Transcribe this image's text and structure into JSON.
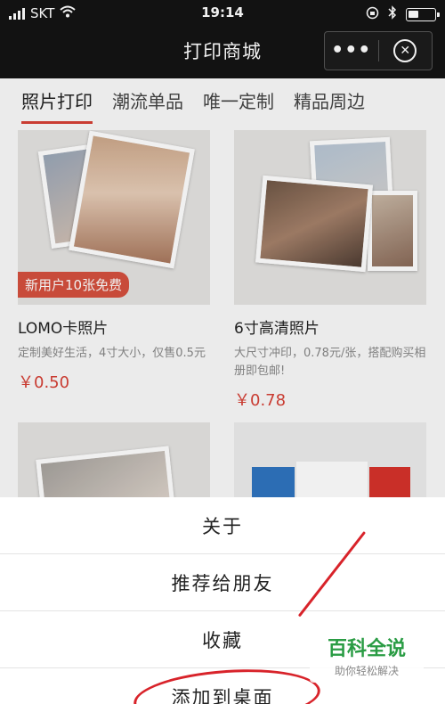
{
  "status_bar": {
    "carrier": "SKT",
    "time": "19:14"
  },
  "header": {
    "title": "打印商城",
    "more_label": "•••"
  },
  "tabs": [
    {
      "label": "照片打印",
      "active": true
    },
    {
      "label": "潮流单品",
      "active": false
    },
    {
      "label": "唯一定制",
      "active": false
    },
    {
      "label": "精品周边",
      "active": false
    }
  ],
  "products": [
    {
      "badge": "新用户10张免费",
      "name": "LOMO卡照片",
      "desc": "定制美好生活，4寸大小，仅售0.5元",
      "price": "￥0.50"
    },
    {
      "badge": "",
      "name": "6寸高清照片",
      "desc": "大尺寸冲印，0.78元/张，搭配购买相册即包邮!",
      "price": "￥0.78"
    }
  ],
  "action_sheet": {
    "items": [
      "关于",
      "推荐给朋友",
      "收藏",
      "添加到桌面"
    ]
  },
  "watermark": {
    "line1": "百科全说",
    "line2": "助你轻松解决"
  },
  "colors": {
    "accent": "#d64036",
    "header_bg": "#141414",
    "annotation": "#d8232a"
  }
}
